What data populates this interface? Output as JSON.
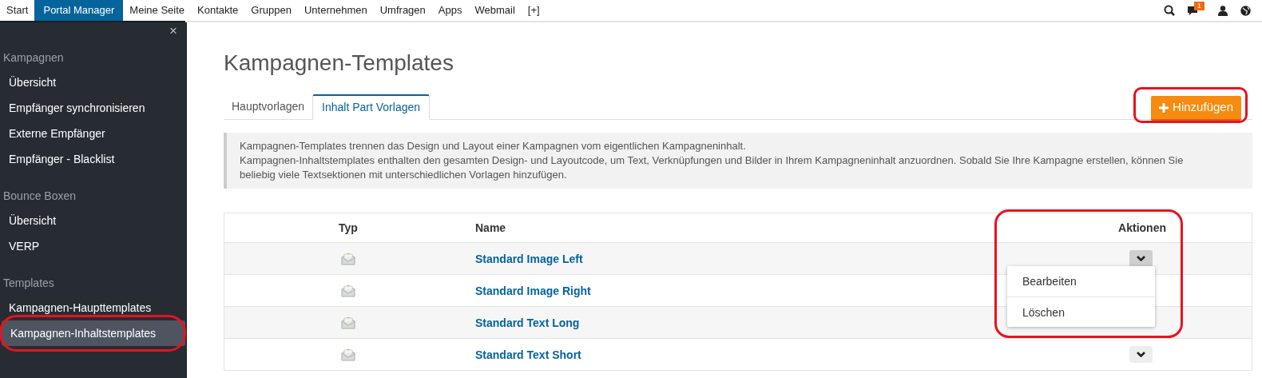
{
  "topnav": {
    "items": [
      {
        "label": "Start",
        "selected": false
      },
      {
        "label": "Portal Manager",
        "selected": true
      },
      {
        "label": "Meine Seite",
        "selected": false
      },
      {
        "label": "Kontakte",
        "selected": false
      },
      {
        "label": "Gruppen",
        "selected": false
      },
      {
        "label": "Unternehmen",
        "selected": false
      },
      {
        "label": "Umfragen",
        "selected": false
      },
      {
        "label": "Apps",
        "selected": false
      },
      {
        "label": "Webmail",
        "selected": false
      },
      {
        "label": "[+]",
        "selected": false
      }
    ],
    "message_count": "1"
  },
  "sidebar": {
    "close": "×",
    "sections": [
      {
        "title": "Kampagnen",
        "items": [
          {
            "label": "Übersicht",
            "selected": false
          },
          {
            "label": "Empfänger synchronisieren",
            "selected": false
          },
          {
            "label": "Externe Empfänger",
            "selected": false
          },
          {
            "label": "Empfänger - Blacklist",
            "selected": false
          }
        ]
      },
      {
        "title": "Bounce Boxen",
        "items": [
          {
            "label": "Übersicht",
            "selected": false
          },
          {
            "label": "VERP",
            "selected": false
          }
        ]
      },
      {
        "title": "Templates",
        "items": [
          {
            "label": "Kampagnen-Haupttemplates",
            "selected": false
          },
          {
            "label": "Kampagnen-Inhaltstemplates",
            "selected": true
          }
        ]
      }
    ]
  },
  "page": {
    "title": "Kampagnen-Templates",
    "tabs": [
      {
        "label": "Hauptvorlagen",
        "selected": false
      },
      {
        "label": "Inhalt Part Vorlagen",
        "selected": true
      }
    ],
    "add_button": "Hinzufügen",
    "info": [
      "Kampagnen-Templates trennen das Design und Layout einer Kampagnen vom eigentlichen Kampagneninhalt.",
      "Kampagnen-Inhaltstemplates enthalten den gesamten Design- und Layoutcode, um Text, Verknüpfungen und Bilder in Ihrem Kampagneninhalt anzuordnen. Sobald Sie Ihre Kampagne erstellen, können Sie beliebig viele Textsektionen mit unterschiedlichen Vorlagen hinzufügen."
    ],
    "table": {
      "columns": [
        "Typ",
        "Name",
        "Aktionen"
      ],
      "rows": [
        {
          "name": "Standard Image Left",
          "menu_open": true,
          "covered": false
        },
        {
          "name": "Standard Image Right",
          "menu_open": false,
          "covered": true
        },
        {
          "name": "Standard Text Long",
          "menu_open": false,
          "covered": true
        },
        {
          "name": "Standard Text Short",
          "menu_open": false,
          "covered": false
        }
      ]
    },
    "action_menu": [
      "Bearbeiten",
      "Löschen"
    ]
  }
}
